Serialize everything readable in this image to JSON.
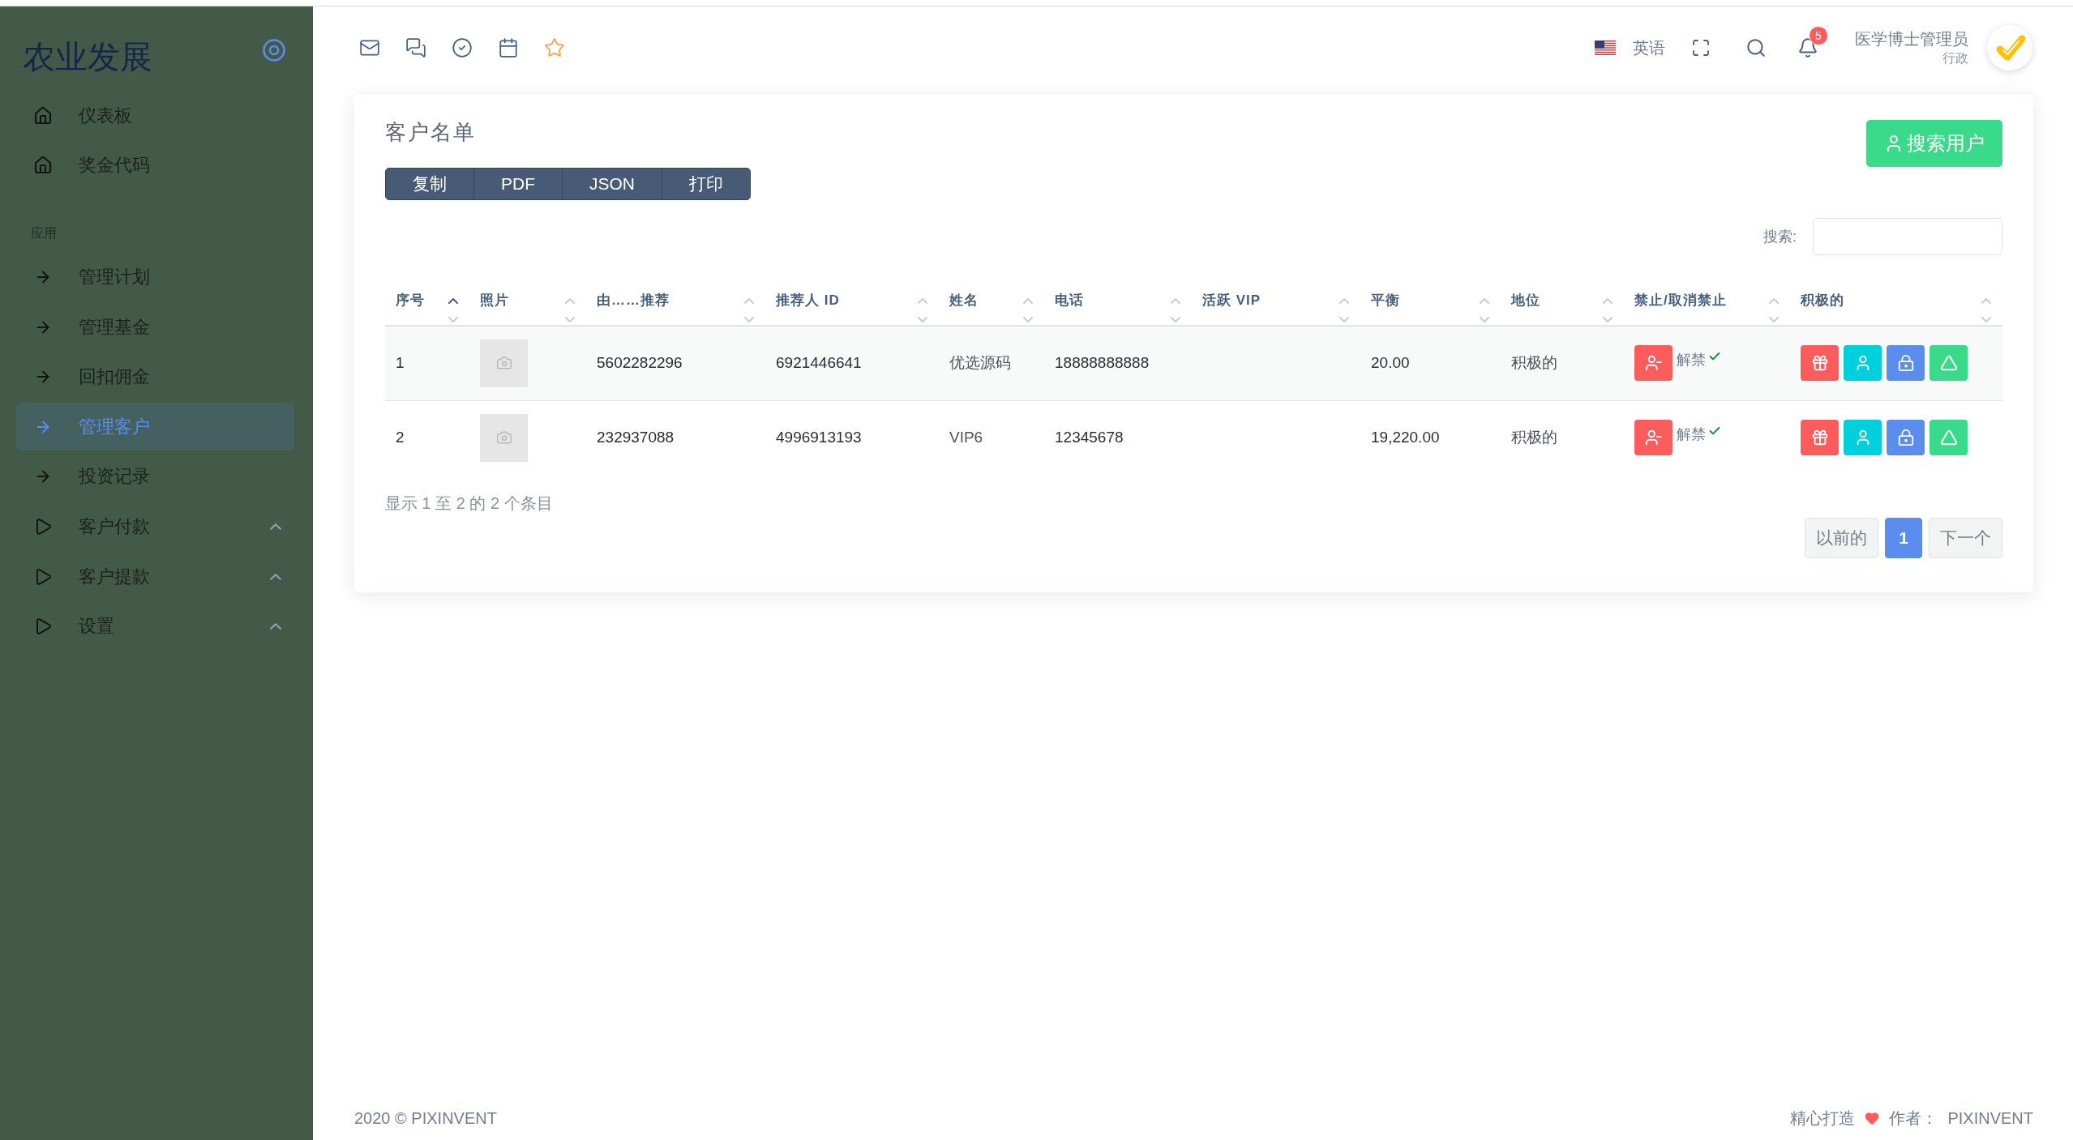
{
  "sidebar": {
    "brand": "农业发展",
    "items": [
      {
        "label": "仪表板",
        "kind": "home",
        "selected": false
      },
      {
        "label": "奖金代码",
        "kind": "home",
        "selected": false
      }
    ],
    "section_title": "应用",
    "section_items": [
      {
        "label": "管理计划",
        "kind": "link",
        "selected": false
      },
      {
        "label": "管理基金",
        "kind": "link",
        "selected": false
      },
      {
        "label": "回扣佣金",
        "kind": "link",
        "selected": false
      },
      {
        "label": "管理客户",
        "kind": "link",
        "selected": true
      },
      {
        "label": "投资记录",
        "kind": "link",
        "selected": false
      },
      {
        "label": "客户付款",
        "kind": "group",
        "selected": false
      },
      {
        "label": "客户提款",
        "kind": "group",
        "selected": false
      },
      {
        "label": "设置",
        "kind": "group",
        "selected": false
      }
    ]
  },
  "navbar": {
    "language": "英语",
    "notification_count": "5",
    "user": {
      "name": "医学博士管理员",
      "role": "行政"
    }
  },
  "card": {
    "title": "客户名单",
    "export_buttons": [
      "复制",
      "PDF",
      "JSON",
      "打印"
    ],
    "search_button": "搜索用户",
    "search": {
      "label": "搜索:"
    },
    "table": {
      "columns": [
        {
          "label": "序号",
          "sorted": true
        },
        {
          "label": "照片",
          "sorted": false
        },
        {
          "label": "由……推荐",
          "sorted": false
        },
        {
          "label": "推荐人 ID",
          "sorted": false
        },
        {
          "label": "姓名",
          "sorted": false
        },
        {
          "label": "电话",
          "sorted": false
        },
        {
          "label": "活跃 VIP",
          "sorted": false
        },
        {
          "label": "平衡",
          "sorted": false
        },
        {
          "label": "地位",
          "sorted": false
        },
        {
          "label": "禁止/取消禁止",
          "sorted": false
        },
        {
          "label": "积极的",
          "sorted": false
        }
      ],
      "rows": [
        {
          "index": "1",
          "referred_by": "5602282296",
          "referrer_id": "6921446641",
          "name": "优选源码",
          "phone": "18888888888",
          "balance": "20.00",
          "status": "积极的",
          "unban_label": "解禁"
        },
        {
          "index": "2",
          "referred_by": "232937088",
          "referrer_id": "4996913193",
          "name": "VIP6",
          "phone": "12345678",
          "balance": "19,220.00",
          "status": "积极的",
          "unban_label": "解禁"
        }
      ]
    },
    "info": "显示 1 至 2 的 2 个条目",
    "pagination": {
      "previous": "以前的",
      "pages": [
        {
          "label": "1",
          "selected": true
        }
      ],
      "next": "下一个"
    }
  },
  "footer": {
    "copyright": "2020 © PIXINVENT",
    "made_with": "精心打造",
    "author_label": "作者：",
    "author": "PIXINVENT"
  }
}
